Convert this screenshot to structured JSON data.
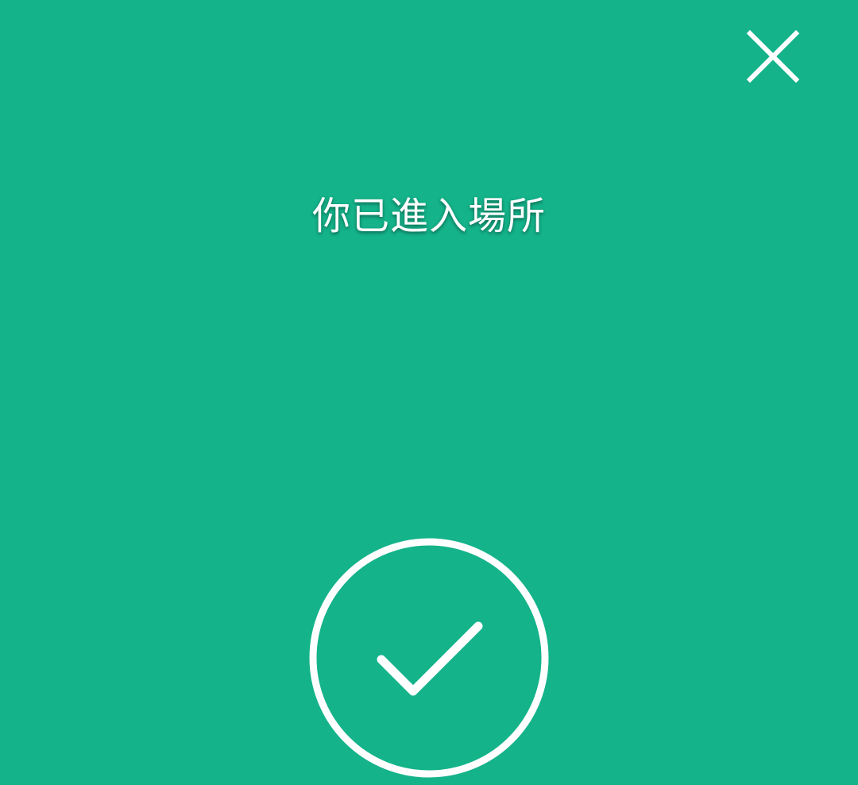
{
  "screen": {
    "background_color": "#14b38a",
    "title": "你已進入場所"
  },
  "close_button": {
    "icon": "close-icon"
  },
  "status": {
    "icon": "check-circle-icon",
    "state": "success"
  }
}
